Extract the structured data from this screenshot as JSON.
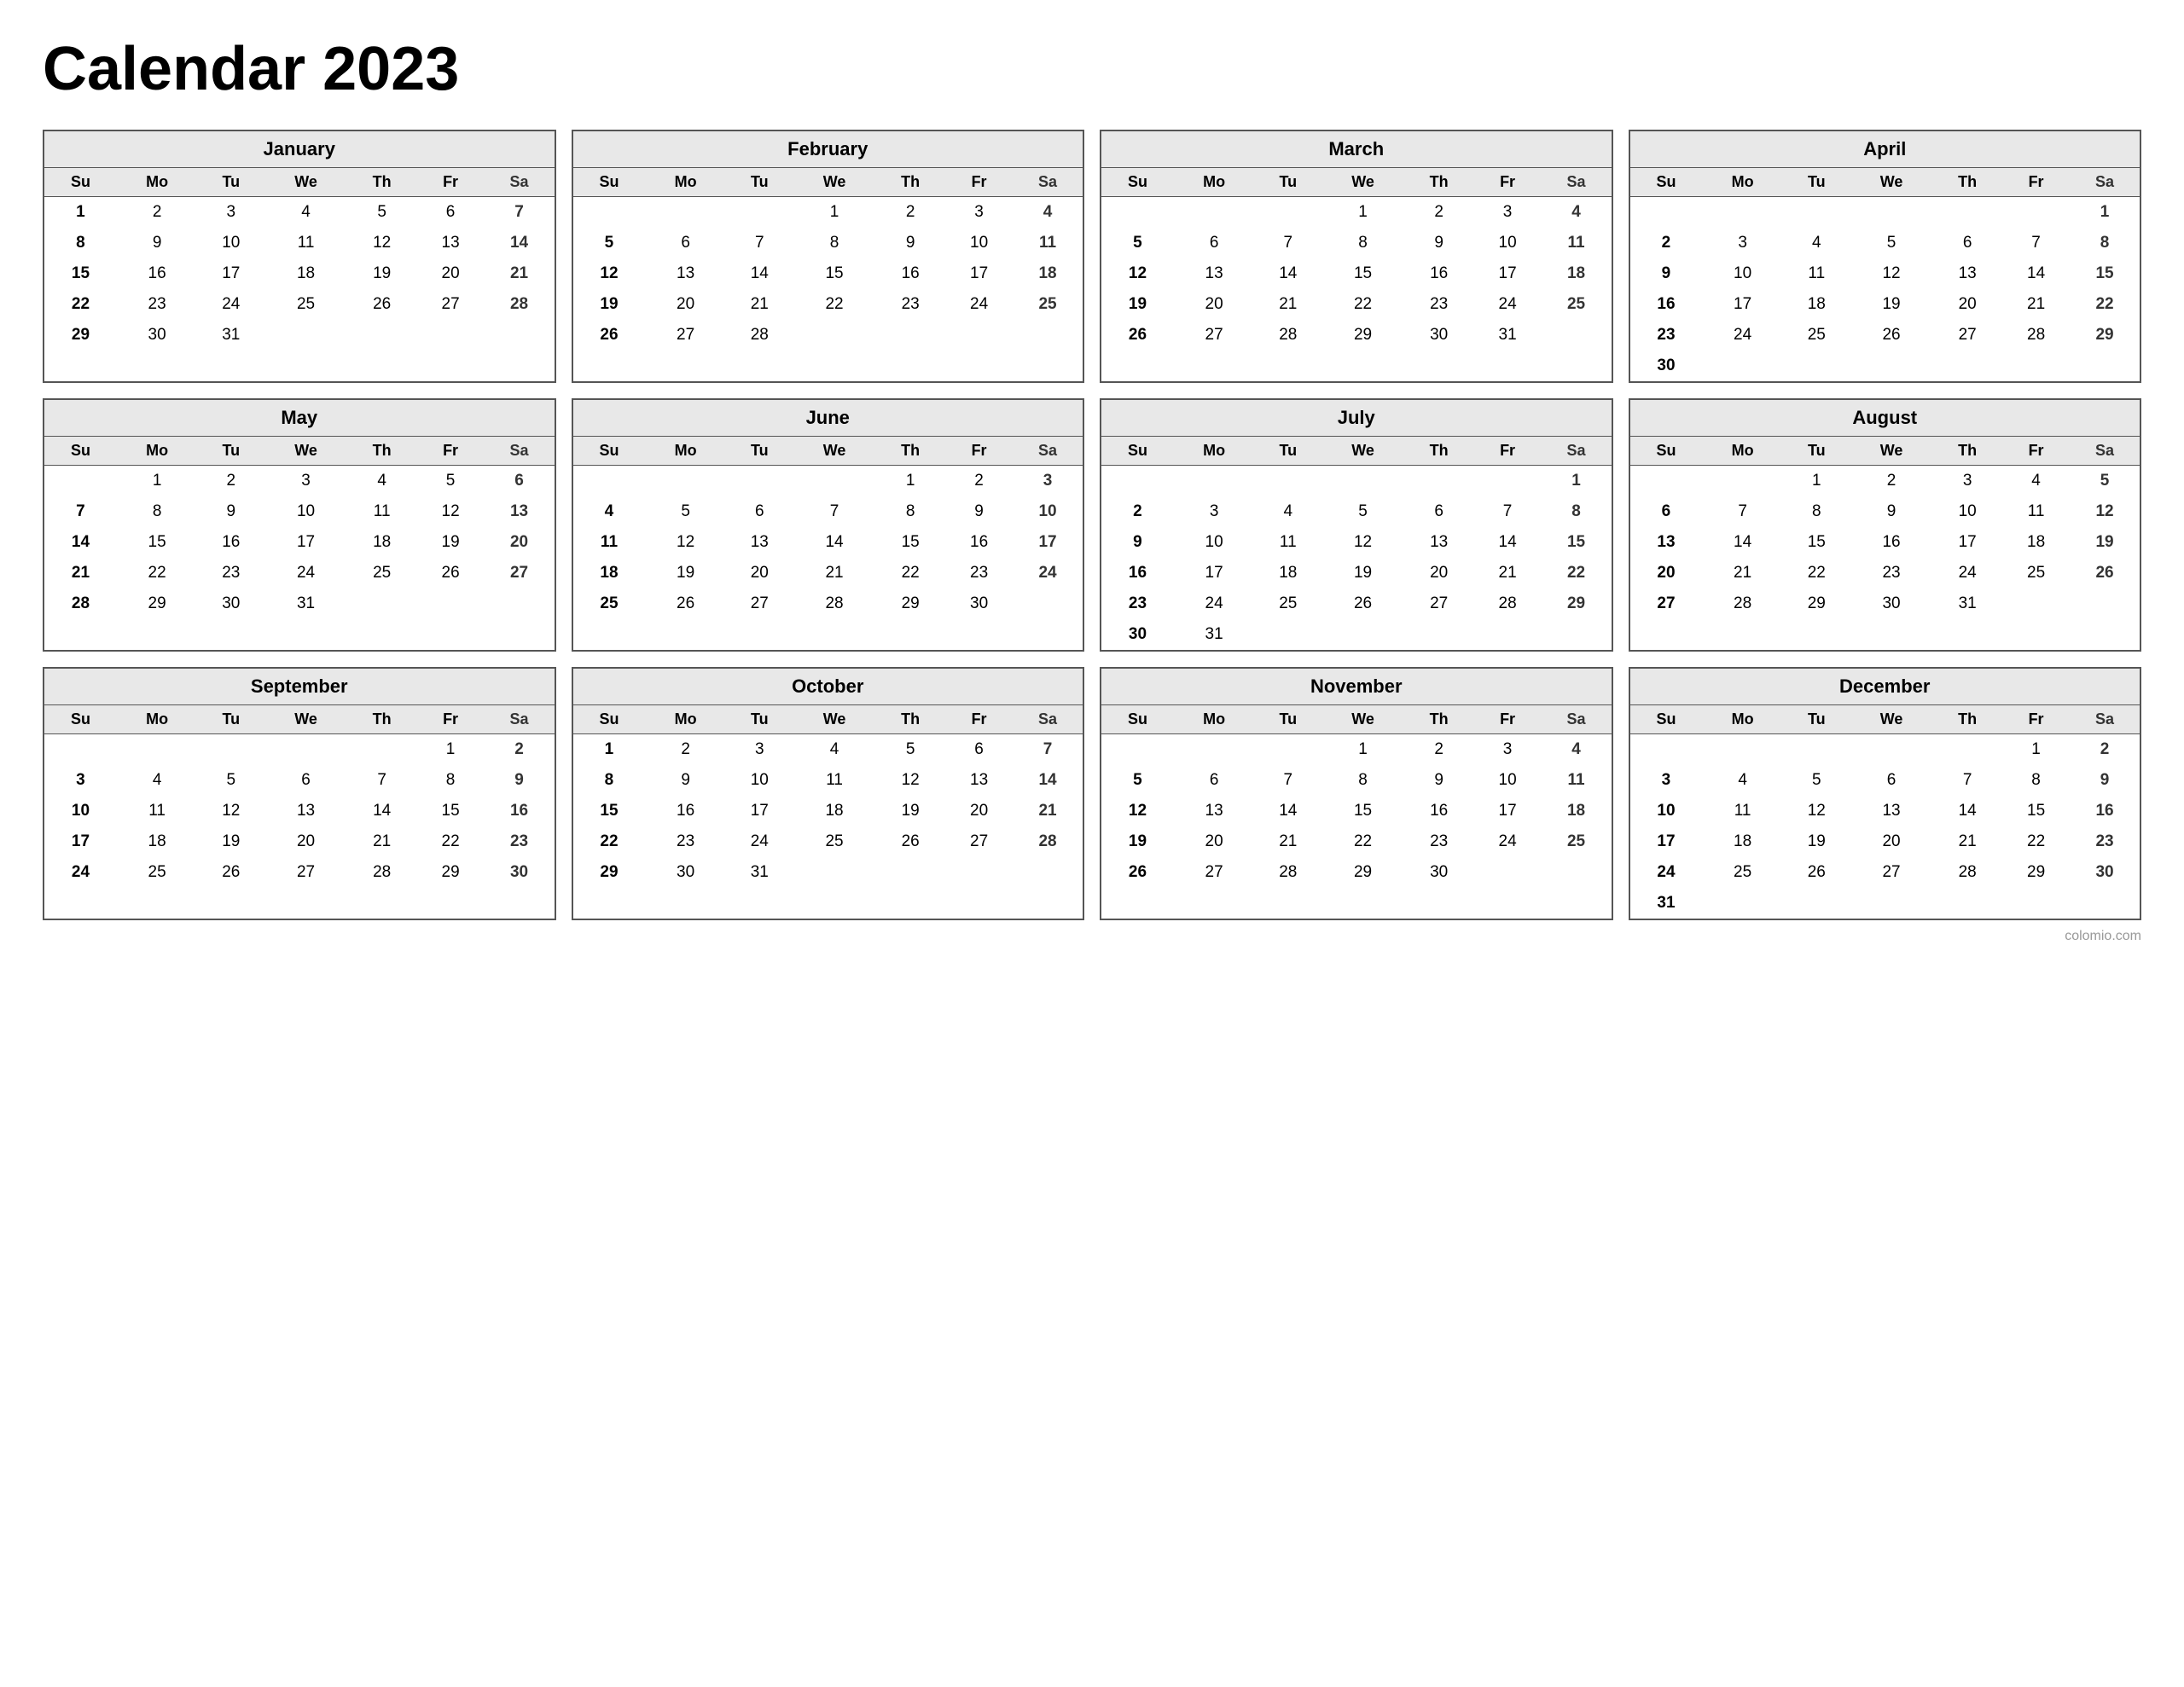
{
  "title": "Calendar 2023",
  "watermark": "colomio.com",
  "months": [
    {
      "name": "January",
      "weeks": [
        [
          "",
          "",
          "",
          "",
          "",
          "",
          ""
        ],
        [
          "1",
          "2",
          "3",
          "4",
          "5",
          "6",
          "7"
        ],
        [
          "8",
          "9",
          "10",
          "11",
          "12",
          "13",
          "14"
        ],
        [
          "15",
          "16",
          "17",
          "18",
          "19",
          "20",
          "21"
        ],
        [
          "22",
          "23",
          "24",
          "25",
          "26",
          "27",
          "28"
        ],
        [
          "29",
          "30",
          "31",
          "",
          "",
          "",
          ""
        ]
      ]
    },
    {
      "name": "February",
      "weeks": [
        [
          "",
          "",
          "",
          "1",
          "2",
          "3",
          "4"
        ],
        [
          "5",
          "6",
          "7",
          "8",
          "9",
          "10",
          "11"
        ],
        [
          "12",
          "13",
          "14",
          "15",
          "16",
          "17",
          "18"
        ],
        [
          "19",
          "20",
          "21",
          "22",
          "23",
          "24",
          "25"
        ],
        [
          "26",
          "27",
          "28",
          "",
          "",
          "",
          ""
        ],
        [
          "",
          "",
          "",
          "",
          "",
          "",
          ""
        ]
      ]
    },
    {
      "name": "March",
      "weeks": [
        [
          "",
          "",
          "",
          "1",
          "2",
          "3",
          "4"
        ],
        [
          "5",
          "6",
          "7",
          "8",
          "9",
          "10",
          "11"
        ],
        [
          "12",
          "13",
          "14",
          "15",
          "16",
          "17",
          "18"
        ],
        [
          "19",
          "20",
          "21",
          "22",
          "23",
          "24",
          "25"
        ],
        [
          "26",
          "27",
          "28",
          "29",
          "30",
          "31",
          ""
        ],
        [
          "",
          "",
          "",
          "",
          "",
          "",
          ""
        ]
      ]
    },
    {
      "name": "April",
      "weeks": [
        [
          "",
          "",
          "",
          "",
          "",
          "",
          "1"
        ],
        [
          "2",
          "3",
          "4",
          "5",
          "6",
          "7",
          "8"
        ],
        [
          "9",
          "10",
          "11",
          "12",
          "13",
          "14",
          "15"
        ],
        [
          "16",
          "17",
          "18",
          "19",
          "20",
          "21",
          "22"
        ],
        [
          "23",
          "24",
          "25",
          "26",
          "27",
          "28",
          "29"
        ],
        [
          "30",
          "",
          "",
          "",
          "",
          "",
          ""
        ]
      ]
    },
    {
      "name": "May",
      "weeks": [
        [
          "",
          "1",
          "2",
          "3",
          "4",
          "5",
          "6"
        ],
        [
          "7",
          "8",
          "9",
          "10",
          "11",
          "12",
          "13"
        ],
        [
          "14",
          "15",
          "16",
          "17",
          "18",
          "19",
          "20"
        ],
        [
          "21",
          "22",
          "23",
          "24",
          "25",
          "26",
          "27"
        ],
        [
          "28",
          "29",
          "30",
          "31",
          "",
          "",
          ""
        ],
        [
          "",
          "",
          "",
          "",
          "",
          "",
          ""
        ]
      ]
    },
    {
      "name": "June",
      "weeks": [
        [
          "",
          "",
          "",
          "",
          "1",
          "2",
          "3"
        ],
        [
          "4",
          "5",
          "6",
          "7",
          "8",
          "9",
          "10"
        ],
        [
          "11",
          "12",
          "13",
          "14",
          "15",
          "16",
          "17"
        ],
        [
          "18",
          "19",
          "20",
          "21",
          "22",
          "23",
          "24"
        ],
        [
          "25",
          "26",
          "27",
          "28",
          "29",
          "30",
          ""
        ],
        [
          "",
          "",
          "",
          "",
          "",
          "",
          ""
        ]
      ]
    },
    {
      "name": "July",
      "weeks": [
        [
          "",
          "",
          "",
          "",
          "",
          "",
          "1"
        ],
        [
          "2",
          "3",
          "4",
          "5",
          "6",
          "7",
          "8"
        ],
        [
          "9",
          "10",
          "11",
          "12",
          "13",
          "14",
          "15"
        ],
        [
          "16",
          "17",
          "18",
          "19",
          "20",
          "21",
          "22"
        ],
        [
          "23",
          "24",
          "25",
          "26",
          "27",
          "28",
          "29"
        ],
        [
          "30",
          "31",
          "",
          "",
          "",
          "",
          ""
        ]
      ]
    },
    {
      "name": "August",
      "weeks": [
        [
          "",
          "",
          "1",
          "2",
          "3",
          "4",
          "5"
        ],
        [
          "6",
          "7",
          "8",
          "9",
          "10",
          "11",
          "12"
        ],
        [
          "13",
          "14",
          "15",
          "16",
          "17",
          "18",
          "19"
        ],
        [
          "20",
          "21",
          "22",
          "23",
          "24",
          "25",
          "26"
        ],
        [
          "27",
          "28",
          "29",
          "30",
          "31",
          "",
          ""
        ],
        [
          "",
          "",
          "",
          "",
          "",
          "",
          ""
        ]
      ]
    },
    {
      "name": "September",
      "weeks": [
        [
          "",
          "",
          "",
          "",
          "",
          "1",
          "2"
        ],
        [
          "3",
          "4",
          "5",
          "6",
          "7",
          "8",
          "9"
        ],
        [
          "10",
          "11",
          "12",
          "13",
          "14",
          "15",
          "16"
        ],
        [
          "17",
          "18",
          "19",
          "20",
          "21",
          "22",
          "23"
        ],
        [
          "24",
          "25",
          "26",
          "27",
          "28",
          "29",
          "30"
        ],
        [
          "",
          "",
          "",
          "",
          "",
          "",
          ""
        ]
      ]
    },
    {
      "name": "October",
      "weeks": [
        [
          "1",
          "2",
          "3",
          "4",
          "5",
          "6",
          "7"
        ],
        [
          "8",
          "9",
          "10",
          "11",
          "12",
          "13",
          "14"
        ],
        [
          "15",
          "16",
          "17",
          "18",
          "19",
          "20",
          "21"
        ],
        [
          "22",
          "23",
          "24",
          "25",
          "26",
          "27",
          "28"
        ],
        [
          "29",
          "30",
          "31",
          "",
          "",
          "",
          ""
        ],
        [
          "",
          "",
          "",
          "",
          "",
          "",
          ""
        ]
      ]
    },
    {
      "name": "November",
      "weeks": [
        [
          "",
          "",
          "",
          "1",
          "2",
          "3",
          "4"
        ],
        [
          "5",
          "6",
          "7",
          "8",
          "9",
          "10",
          "11"
        ],
        [
          "12",
          "13",
          "14",
          "15",
          "16",
          "17",
          "18"
        ],
        [
          "19",
          "20",
          "21",
          "22",
          "23",
          "24",
          "25"
        ],
        [
          "26",
          "27",
          "28",
          "29",
          "30",
          "",
          ""
        ],
        [
          "",
          "",
          "",
          "",
          "",
          "",
          ""
        ]
      ]
    },
    {
      "name": "December",
      "weeks": [
        [
          "",
          "",
          "",
          "",
          "",
          "1",
          "2"
        ],
        [
          "3",
          "4",
          "5",
          "6",
          "7",
          "8",
          "9"
        ],
        [
          "10",
          "11",
          "12",
          "13",
          "14",
          "15",
          "16"
        ],
        [
          "17",
          "18",
          "19",
          "20",
          "21",
          "22",
          "23"
        ],
        [
          "24",
          "25",
          "26",
          "27",
          "28",
          "29",
          "30"
        ],
        [
          "31",
          "",
          "",
          "",
          "",
          "",
          ""
        ]
      ]
    }
  ],
  "days": [
    "Su",
    "Mo",
    "Tu",
    "We",
    "Th",
    "Fr",
    "Sa"
  ]
}
